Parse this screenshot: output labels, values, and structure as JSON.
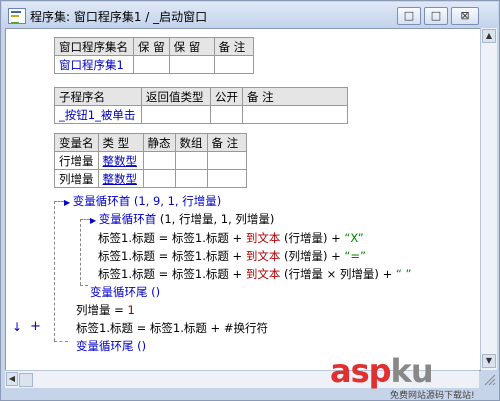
{
  "window": {
    "title": "程序集: 窗口程序集1 / _启动窗口",
    "buttons": {
      "min": "□",
      "max": "□",
      "close": "⊠"
    }
  },
  "assembly_table": {
    "headers": [
      "窗口程序集名",
      "保 留",
      "保 留",
      "备 注"
    ],
    "row": [
      "窗口程序集1",
      "",
      "",
      ""
    ]
  },
  "sub_table": {
    "headers": [
      "子程序名",
      "返回值类型",
      "公开",
      "备 注"
    ],
    "row": [
      "_按钮1_被单击",
      "",
      "",
      ""
    ]
  },
  "var_table": {
    "headers": [
      "变量名",
      "类 型",
      "静态",
      "数组",
      "备 注"
    ],
    "rows": [
      [
        "行增量",
        "整数型",
        "",
        "",
        ""
      ],
      [
        "列增量",
        "整数型",
        "",
        "",
        ""
      ]
    ]
  },
  "code": {
    "line1_kw": "变量循环首",
    "line1_args": "(1, 9, 1, 行增量)",
    "line2_kw": "变量循环首",
    "line2_args": "(1, 行增量, 1, 列增量)",
    "line3_a": "标签1.标题 = 标签1.标题 + ",
    "line3_fn": "到文本",
    "line3_b": " (行增量) + ",
    "line3_str": "“X”",
    "line4_a": "标签1.标题 = 标签1.标题 + ",
    "line4_fn": "到文本",
    "line4_b": " (列增量) + ",
    "line4_str": "“=”",
    "line5_a": "标签1.标题 = 标签1.标题 + ",
    "line5_fn": "到文本",
    "line5_b": " (行增量 × 列增量) + ",
    "line5_str": "“  ”",
    "line6_kw": "变量循环尾",
    "line6_args": "()",
    "line7_a": "列增量 = ",
    "line7_num": "1",
    "line8": "标签1.标题 = 标签1.标题 + #换行符",
    "line9_kw": "变量循环尾",
    "line9_args": "()"
  },
  "markers": {
    "arrow": "↓",
    "plus": "+"
  },
  "watermark": {
    "brand_a": "asp",
    "brand_b": "ku",
    "sub": "免费网站源码下载站!"
  }
}
